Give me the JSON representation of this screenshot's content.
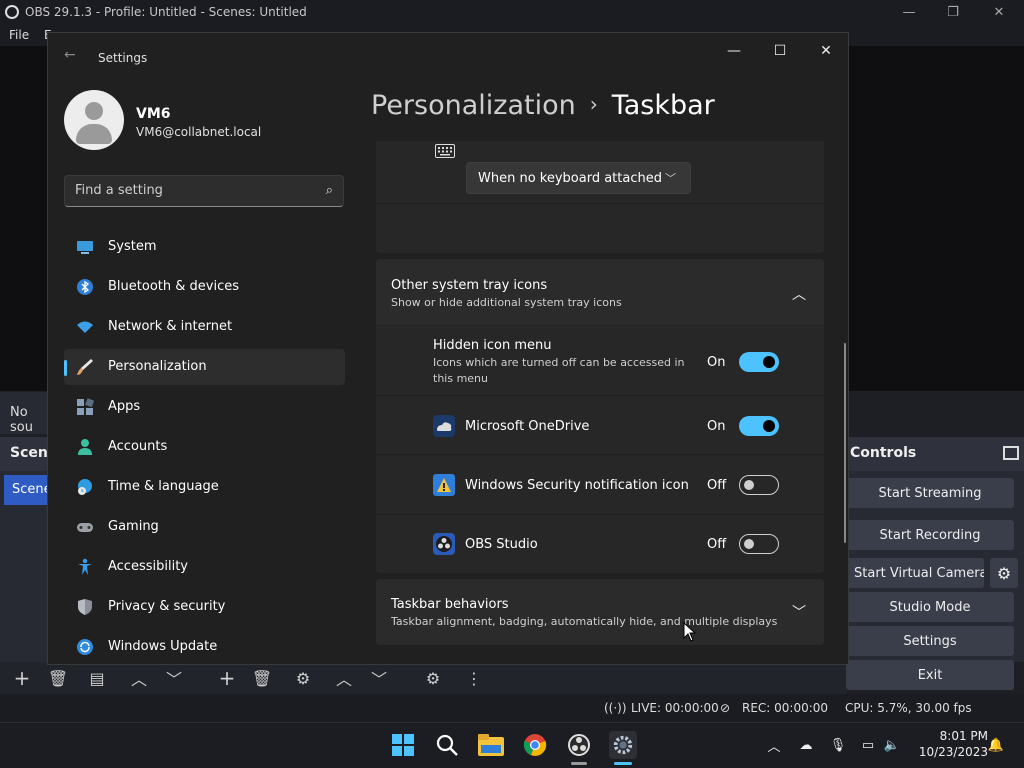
{
  "obs": {
    "title": "OBS 29.1.3 - Profile: Untitled - Scenes: Untitled",
    "menu": [
      "File",
      "E"
    ],
    "sources_empty": "No sou",
    "scenes_header": "Scene",
    "scene_item": "Scene",
    "controls_header": "Controls",
    "controls": [
      "Start Streaming",
      "Start Recording",
      "Start Virtual Camera",
      "Studio Mode",
      "Settings",
      "Exit"
    ],
    "status": {
      "live": "LIVE: 00:00:00",
      "rec": "REC: 00:00:00",
      "cpu": "CPU: 5.7%, 30.00 fps"
    }
  },
  "settings": {
    "window_title": "Settings",
    "user": {
      "name": "VM6",
      "email": "VM6@collabnet.local"
    },
    "search": {
      "placeholder": "Find a setting"
    },
    "nav": [
      {
        "label": "System",
        "icon": "monitor-icon",
        "color": "#3a9bdc"
      },
      {
        "label": "Bluetooth & devices",
        "icon": "bluetooth-icon",
        "color": "#2f7fd8"
      },
      {
        "label": "Network & internet",
        "icon": "wifi-icon",
        "color": "#3aa0e8"
      },
      {
        "label": "Personalization",
        "icon": "brush-icon",
        "color": "#e0a060"
      },
      {
        "label": "Apps",
        "icon": "apps-icon",
        "color": "#8aa0b8"
      },
      {
        "label": "Accounts",
        "icon": "person-icon",
        "color": "#3cc0a0"
      },
      {
        "label": "Time & language",
        "icon": "globe-clock-icon",
        "color": "#2f9be0"
      },
      {
        "label": "Gaming",
        "icon": "gamepad-icon",
        "color": "#9aa0a8"
      },
      {
        "label": "Accessibility",
        "icon": "accessibility-icon",
        "color": "#3a9be8"
      },
      {
        "label": "Privacy & security",
        "icon": "shield-icon",
        "color": "#8a8f98"
      },
      {
        "label": "Windows Update",
        "icon": "update-icon",
        "color": "#2f8be0"
      }
    ],
    "breadcrumb": {
      "parent": "Personalization",
      "separator": "›",
      "current": "Taskbar"
    },
    "keyboard_dropdown": "When no keyboard attached",
    "tray": {
      "title": "Other system tray icons",
      "desc": "Show or hide additional system tray icons",
      "items": [
        {
          "title": "Hidden icon menu",
          "desc": "Icons which are turned off can be accessed in this menu",
          "state": "On"
        },
        {
          "title": "Microsoft OneDrive",
          "state": "On"
        },
        {
          "title": "Windows Security notification icon",
          "state": "Off"
        },
        {
          "title": "OBS Studio",
          "state": "Off"
        }
      ]
    },
    "behaviors": {
      "title": "Taskbar behaviors",
      "desc": "Taskbar alignment, badging, automatically hide, and multiple displays"
    }
  },
  "taskbar": {
    "time": "8:01 PM",
    "date": "10/23/2023"
  },
  "colors": {
    "accent": "#4cc2ff",
    "obs_blue": "#2f5cc4"
  }
}
